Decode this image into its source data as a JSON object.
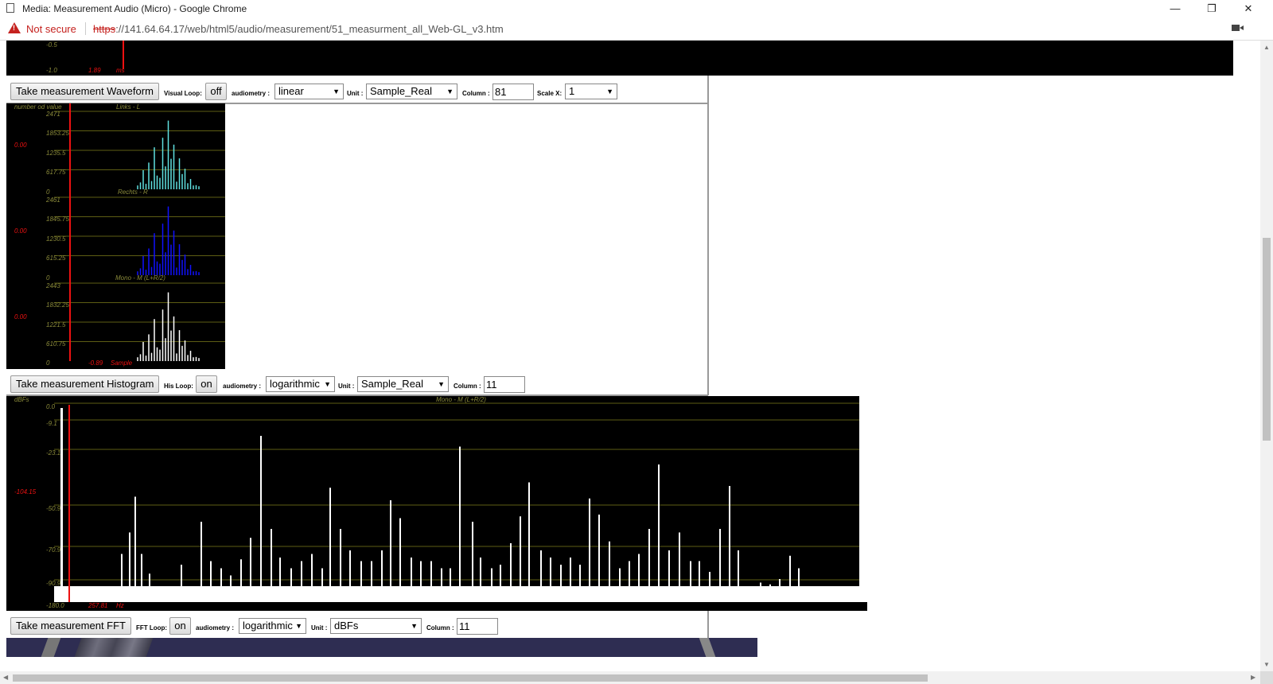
{
  "window": {
    "title": "Media: Measurement Audio (Micro) - Google Chrome",
    "minimize": "—",
    "restore": "❐",
    "close": "✕"
  },
  "address": {
    "security": "Not secure",
    "scheme": "https",
    "rest": "://141.64.64.17/web/html5/audio/measurement/51_measurment_all_Web-GL_v3.htm"
  },
  "waveform": {
    "ticks": [
      "-0.5",
      "-1.0"
    ],
    "cursor_value": "1.89",
    "unit": "ms",
    "button": "Take measurement Waveform",
    "loop_label": "Visual Loop:",
    "loop_value": "off",
    "audiometry_label": "audiometry :",
    "audiometry_value": "linear",
    "unit_label": "Unit :",
    "unit_value": "Sample_Real",
    "column_label": "Column :",
    "column_value": "81",
    "scale_label": "Scale X:",
    "scale_value": "1"
  },
  "histogram": {
    "header_left": "number od value",
    "panels": [
      {
        "name": "Links - L",
        "ticks": [
          "2471",
          "1853.25",
          "1235.5",
          "617.75",
          "0"
        ],
        "cursor": "0.00",
        "color": "#5fe0e0"
      },
      {
        "name": "Rechts - R",
        "ticks": [
          "2461",
          "1845.75",
          "1230.5",
          "615.25",
          "0"
        ],
        "cursor": "0.00",
        "color": "#1010ff"
      },
      {
        "name": "Mono - M (L+R/2)",
        "ticks": [
          "2443",
          "1832.25",
          "1221.5",
          "610.75",
          "0"
        ],
        "cursor": "0.00",
        "color": "#ffffff"
      }
    ],
    "footer_value": "-0.89",
    "footer_unit": "Sample",
    "button": "Take measurement Histogram",
    "loop_label": "His Loop:",
    "loop_value": "on",
    "audiometry_label": "audiometry :",
    "audiometry_value": "logarithmic",
    "unit_label": "Unit :",
    "unit_value": "Sample_Real",
    "column_label": "Column :",
    "column_value": "11"
  },
  "fft": {
    "ylabel": "dBFs",
    "series_name": "Mono - M (L+R/2)",
    "ticks": [
      "0.0",
      "-9.1",
      "-23.1",
      "-50.9",
      "-70.9",
      "-90.9",
      "-180.0"
    ],
    "cursor_value": "-104.15",
    "footer_value": "257.81",
    "footer_unit": "Hz",
    "button": "Take measurement FFT",
    "loop_label": "FFT Loop:",
    "loop_value": "on",
    "audiometry_label": "audiometry :",
    "audiometry_value": "logarithmic",
    "unit_label": "Unit :",
    "unit_value": "dBFs",
    "column_label": "Column :",
    "column_value": "11"
  }
}
